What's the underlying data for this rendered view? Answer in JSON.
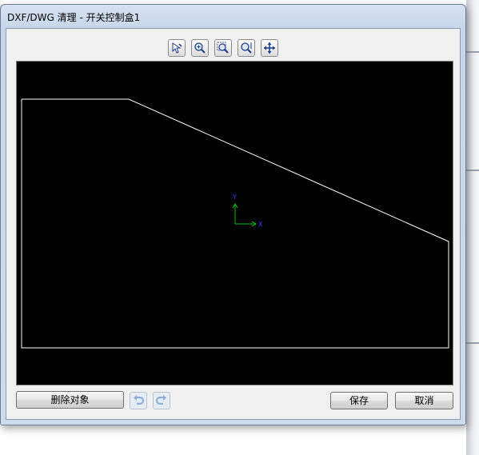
{
  "window": {
    "title": "DXF/DWG 清理 - 开关控制盒1"
  },
  "toolbar": {
    "tools": [
      {
        "icon": "select-icon"
      },
      {
        "icon": "zoom-in-icon"
      },
      {
        "icon": "zoom-window-icon"
      },
      {
        "icon": "zoom-fit-icon"
      },
      {
        "icon": "pan-icon"
      }
    ]
  },
  "canvas": {
    "background": "#000000",
    "geometry_color": "#ffffff",
    "axis": {
      "x_label": "X",
      "y_label": "Y",
      "x_color": "#00c000",
      "y_color": "#00c000",
      "label_color": "#3040ff"
    }
  },
  "footer": {
    "delete_label": "删除对象",
    "undo_icon": "undo-icon",
    "redo_icon": "redo-icon",
    "save_label": "保存",
    "cancel_label": "取消"
  }
}
